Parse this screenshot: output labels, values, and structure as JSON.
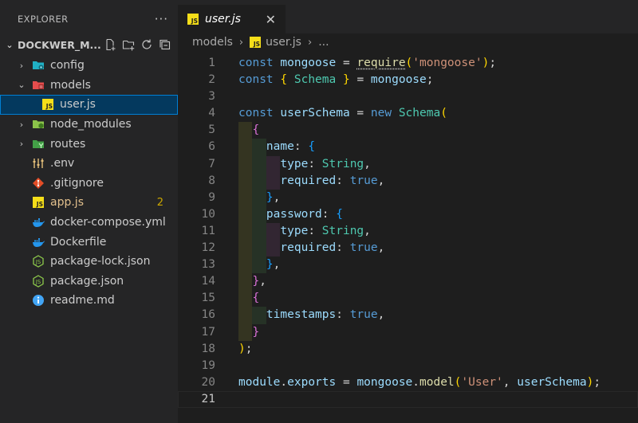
{
  "sidebar": {
    "header": "EXPLORER",
    "more_icon": "ellipsis-icon",
    "project": "DOCKWER_M...",
    "items": [
      {
        "label": "config",
        "type": "folder",
        "expanded": false,
        "icon": "folder-config-icon"
      },
      {
        "label": "models",
        "type": "folder",
        "expanded": true,
        "icon": "folder-models-icon"
      },
      {
        "label": "user.js",
        "type": "file",
        "icon": "js-file-icon",
        "selected": true
      },
      {
        "label": "node_modules",
        "type": "folder",
        "expanded": false,
        "icon": "folder-node-icon"
      },
      {
        "label": "routes",
        "type": "folder",
        "expanded": false,
        "icon": "folder-routes-icon"
      },
      {
        "label": ".env",
        "type": "file",
        "icon": "env-icon"
      },
      {
        "label": ".gitignore",
        "type": "file",
        "icon": "git-icon"
      },
      {
        "label": "app.js",
        "type": "file",
        "icon": "js-file-icon",
        "badge": "2"
      },
      {
        "label": "docker-compose.yml",
        "type": "file",
        "icon": "docker-icon"
      },
      {
        "label": "Dockerfile",
        "type": "file",
        "icon": "docker-icon"
      },
      {
        "label": "package-lock.json",
        "type": "file",
        "icon": "nodejs-icon"
      },
      {
        "label": "package.json",
        "type": "file",
        "icon": "nodejs-icon"
      },
      {
        "label": "readme.md",
        "type": "file",
        "icon": "info-icon"
      }
    ]
  },
  "editor": {
    "tab": {
      "label": "user.js",
      "badge": "JS",
      "close": "✕"
    },
    "breadcrumb": {
      "folder": "models",
      "file": "user.js",
      "tail": "..."
    },
    "line_numbers": [
      "1",
      "2",
      "3",
      "4",
      "5",
      "6",
      "7",
      "8",
      "9",
      "10",
      "11",
      "12",
      "13",
      "14",
      "15",
      "16",
      "17",
      "18",
      "19",
      "20",
      "21"
    ],
    "current_line": 21
  },
  "colors": {
    "keyword": "#569cd6",
    "variable": "#9cdcfe",
    "function": "#dcdcaa",
    "class": "#4ec9b0",
    "string": "#ce9178",
    "bracket_1": "#ffd700",
    "bracket_2": "#da70d6",
    "bracket_3": "#179fff"
  },
  "code": [
    [
      [
        "kw",
        "const "
      ],
      [
        "var",
        "mongoose"
      ],
      [
        "pl",
        " = "
      ],
      [
        "fn squiggle",
        "require"
      ],
      [
        "b1",
        "("
      ],
      [
        "str",
        "'mongoose'"
      ],
      [
        "b1",
        ")"
      ],
      [
        "pl",
        ";"
      ]
    ],
    [
      [
        "kw",
        "const "
      ],
      [
        "b1",
        "{ "
      ],
      [
        "cls",
        "Schema"
      ],
      [
        "b1",
        " }"
      ],
      [
        "pl",
        " = "
      ],
      [
        "var",
        "mongoose"
      ],
      [
        "pl",
        ";"
      ]
    ],
    [],
    [
      [
        "kw",
        "const "
      ],
      [
        "var",
        "userSchema"
      ],
      [
        "pl",
        " = "
      ],
      [
        "kw",
        "new "
      ],
      [
        "cls",
        "Schema"
      ],
      [
        "b1",
        "("
      ]
    ],
    [
      [
        "pl",
        "  "
      ],
      [
        "b2",
        "{"
      ]
    ],
    [
      [
        "pl",
        "    "
      ],
      [
        "var",
        "name"
      ],
      [
        "pl",
        ": "
      ],
      [
        "b3",
        "{"
      ]
    ],
    [
      [
        "pl",
        "      "
      ],
      [
        "var",
        "type"
      ],
      [
        "pl",
        ": "
      ],
      [
        "cls",
        "String"
      ],
      [
        "pl",
        ","
      ]
    ],
    [
      [
        "pl",
        "      "
      ],
      [
        "var",
        "required"
      ],
      [
        "pl",
        ": "
      ],
      [
        "kw",
        "true"
      ],
      [
        "pl",
        ","
      ]
    ],
    [
      [
        "pl",
        "    "
      ],
      [
        "b3",
        "}"
      ],
      [
        "pl",
        ","
      ]
    ],
    [
      [
        "pl",
        "    "
      ],
      [
        "var",
        "password"
      ],
      [
        "pl",
        ": "
      ],
      [
        "b3",
        "{"
      ]
    ],
    [
      [
        "pl",
        "      "
      ],
      [
        "var",
        "type"
      ],
      [
        "pl",
        ": "
      ],
      [
        "cls",
        "String"
      ],
      [
        "pl",
        ","
      ]
    ],
    [
      [
        "pl",
        "      "
      ],
      [
        "var",
        "required"
      ],
      [
        "pl",
        ": "
      ],
      [
        "kw",
        "true"
      ],
      [
        "pl",
        ","
      ]
    ],
    [
      [
        "pl",
        "    "
      ],
      [
        "b3",
        "}"
      ],
      [
        "pl",
        ","
      ]
    ],
    [
      [
        "pl",
        "  "
      ],
      [
        "b2",
        "}"
      ],
      [
        "pl",
        ","
      ]
    ],
    [
      [
        "pl",
        "  "
      ],
      [
        "b2",
        "{"
      ]
    ],
    [
      [
        "pl",
        "    "
      ],
      [
        "var",
        "timestamps"
      ],
      [
        "pl",
        ": "
      ],
      [
        "kw",
        "true"
      ],
      [
        "pl",
        ","
      ]
    ],
    [
      [
        "pl",
        "  "
      ],
      [
        "b2",
        "}"
      ]
    ],
    [
      [
        "b1",
        ")"
      ],
      [
        "pl",
        ";"
      ]
    ],
    [],
    [
      [
        "var",
        "module"
      ],
      [
        "pl",
        "."
      ],
      [
        "var",
        "exports"
      ],
      [
        "pl",
        " = "
      ],
      [
        "var",
        "mongoose"
      ],
      [
        "pl",
        "."
      ],
      [
        "fn",
        "model"
      ],
      [
        "b1",
        "("
      ],
      [
        "str",
        "'User'"
      ],
      [
        "pl",
        ", "
      ],
      [
        "var",
        "userSchema"
      ],
      [
        "b1",
        ")"
      ],
      [
        "pl",
        ";"
      ]
    ],
    []
  ]
}
